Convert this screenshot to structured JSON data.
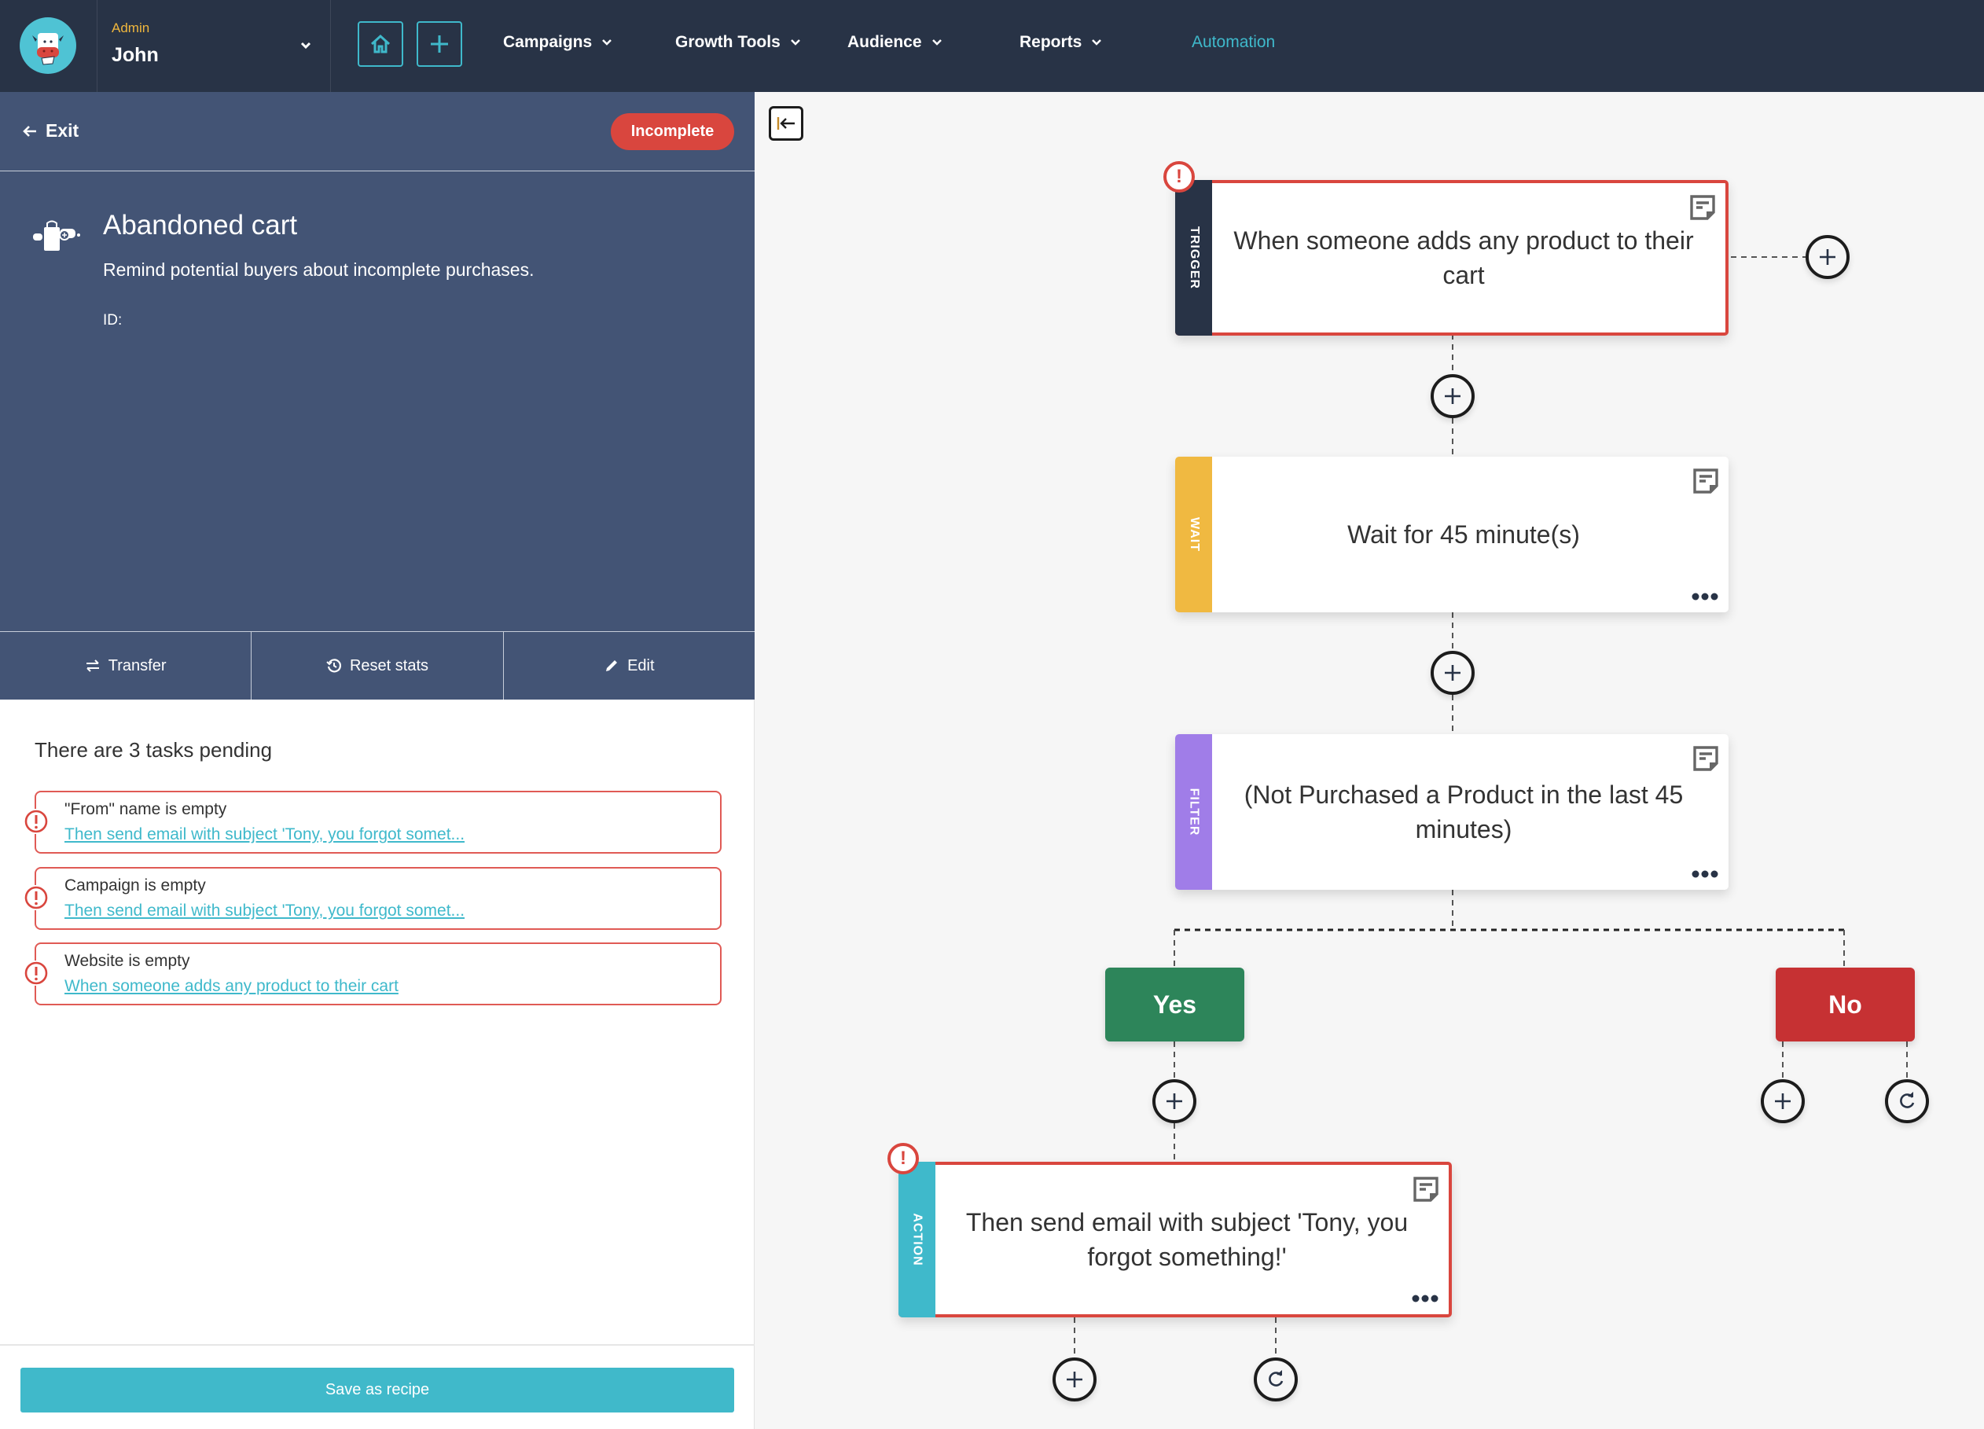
{
  "nav": {
    "user_role": "Admin",
    "user_name": "John",
    "items": [
      {
        "label": "Campaigns",
        "has_dropdown": true
      },
      {
        "label": "Growth Tools",
        "has_dropdown": true
      },
      {
        "label": "Audience",
        "has_dropdown": true
      },
      {
        "label": "Reports",
        "has_dropdown": true
      },
      {
        "label": "Automation",
        "has_dropdown": false,
        "active": true
      }
    ],
    "icons": {
      "home": "home-icon",
      "add": "plus-icon"
    }
  },
  "recipe": {
    "exit_label": "Exit",
    "status": "Incomplete",
    "title": "Abandoned cart",
    "description": "Remind potential buyers about incomplete purchases.",
    "id_label": "ID:",
    "actions": [
      {
        "label": "Transfer",
        "icon": "transfer-icon"
      },
      {
        "label": "Reset stats",
        "icon": "history-icon"
      },
      {
        "label": "Edit",
        "icon": "pencil-icon"
      }
    ]
  },
  "tasks": {
    "title": "There are 3 tasks pending",
    "items": [
      {
        "label": "\"From\" name is empty",
        "link": "Then send email with subject 'Tony, you forgot somet..."
      },
      {
        "label": "Campaign is empty",
        "link": "Then send email with subject 'Tony, you forgot somet..."
      },
      {
        "label": "Website is empty",
        "link": "When someone adds any product to their cart"
      }
    ]
  },
  "footer": {
    "save_label": "Save as recipe"
  },
  "flow": {
    "nodes": [
      {
        "type": "TRIGGER",
        "text": "When someone adds any product to their cart",
        "color": "#283346",
        "error": true,
        "show_more": false
      },
      {
        "type": "WAIT",
        "text": "Wait for 45 minute(s)",
        "color": "#f0b941",
        "error": false,
        "show_more": true
      },
      {
        "type": "FILTER",
        "text": "(Not Purchased a Product in the last 45 minutes)",
        "color": "#a07de8",
        "error": false,
        "show_more": true
      },
      {
        "type": "ACTION",
        "text": "Then send email with subject 'Tony, you forgot something!'",
        "color": "#3fb9cb",
        "error": true,
        "show_more": true
      }
    ],
    "branches": {
      "yes": "Yes",
      "no": "No"
    }
  },
  "colors": {
    "nav_bg": "#283346",
    "panel_bg": "#435475",
    "accent": "#3fb9cb",
    "error": "#d9463e",
    "admin": "#f0b73d"
  }
}
